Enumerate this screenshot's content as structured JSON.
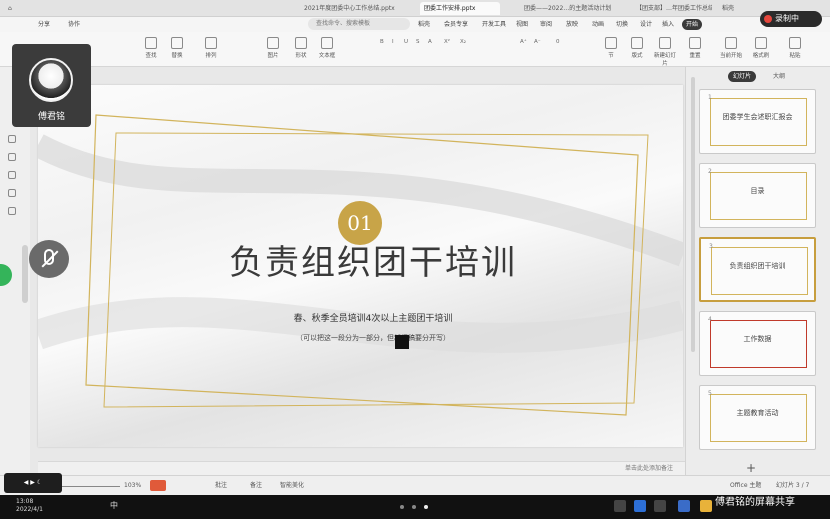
{
  "tabs": [
    {
      "label": "稻壳",
      "active": false
    },
    {
      "label": "2021年度团委中心工作总结.pptx",
      "active": false
    },
    {
      "label": "团委工作安排.pptx",
      "active": true
    },
    {
      "label": "团委——2022…的主题活动计划",
      "active": false
    },
    {
      "label": "【团支部】…年团委工作总结",
      "active": false
    },
    {
      "label": "团委工作总结",
      "active": false
    }
  ],
  "recording": {
    "label": "录制中"
  },
  "menubar": {
    "items": [
      "开始",
      "插入",
      "设计",
      "切换",
      "动画",
      "放映",
      "审阅",
      "视图",
      "开发工具",
      "会员专享",
      "稻壳"
    ],
    "active": "开始",
    "search_placeholder": "查找命令、搜索模板",
    "share": "分享",
    "collab": "协作"
  },
  "toolbar": {
    "tools": [
      "粘贴",
      "格式刷",
      "当前开始",
      "新建幻灯片",
      "版式",
      "节",
      "重置",
      "文本框",
      "形状",
      "排列",
      "图片",
      "查找",
      "替换"
    ],
    "font_size": "0",
    "minis": [
      "B",
      "I",
      "U",
      "S",
      "A",
      "X²",
      "X₂",
      "A⁺",
      "A⁻"
    ]
  },
  "slide": {
    "number": "01",
    "title": "负责组织团干培训",
    "subtitle": "春、秋季全员培训4次以上主题团干培训",
    "note": "（可以把这一段分为一部分，但新闻稿要分开写）"
  },
  "notes_placeholder": "单击此处添加备注",
  "thumb_panel": {
    "tabs": [
      "大纲",
      "幻灯片"
    ],
    "active_tab": "幻灯片",
    "slides": [
      {
        "index": "1",
        "title": "团委学生会述职汇报会"
      },
      {
        "index": "2",
        "title": "目录"
      },
      {
        "index": "3",
        "title": "负责组织团干培训",
        "active": true
      },
      {
        "index": "4",
        "title": "工作数据"
      },
      {
        "index": "5",
        "title": "主题教育活动"
      }
    ],
    "add_label": "+"
  },
  "statusbar": {
    "slide_info": "幻灯片 3 / 7",
    "theme": "Office 主题",
    "smart_beautify": "智能美化",
    "notes": "备注",
    "comment": "批注",
    "zoom": "103%"
  },
  "webcam": {
    "name": "傅君铭"
  },
  "share_screen": {
    "label": "傅君铭的屏幕共享"
  },
  "taskbar": {
    "time": "13:08",
    "date": "2022/4/1",
    "ime": "中"
  },
  "colors": {
    "accent_gold": "#c8a448",
    "recording_red": "#e6463c",
    "status_red": "#e05a3a",
    "slide_frame": "#d2b45c"
  }
}
